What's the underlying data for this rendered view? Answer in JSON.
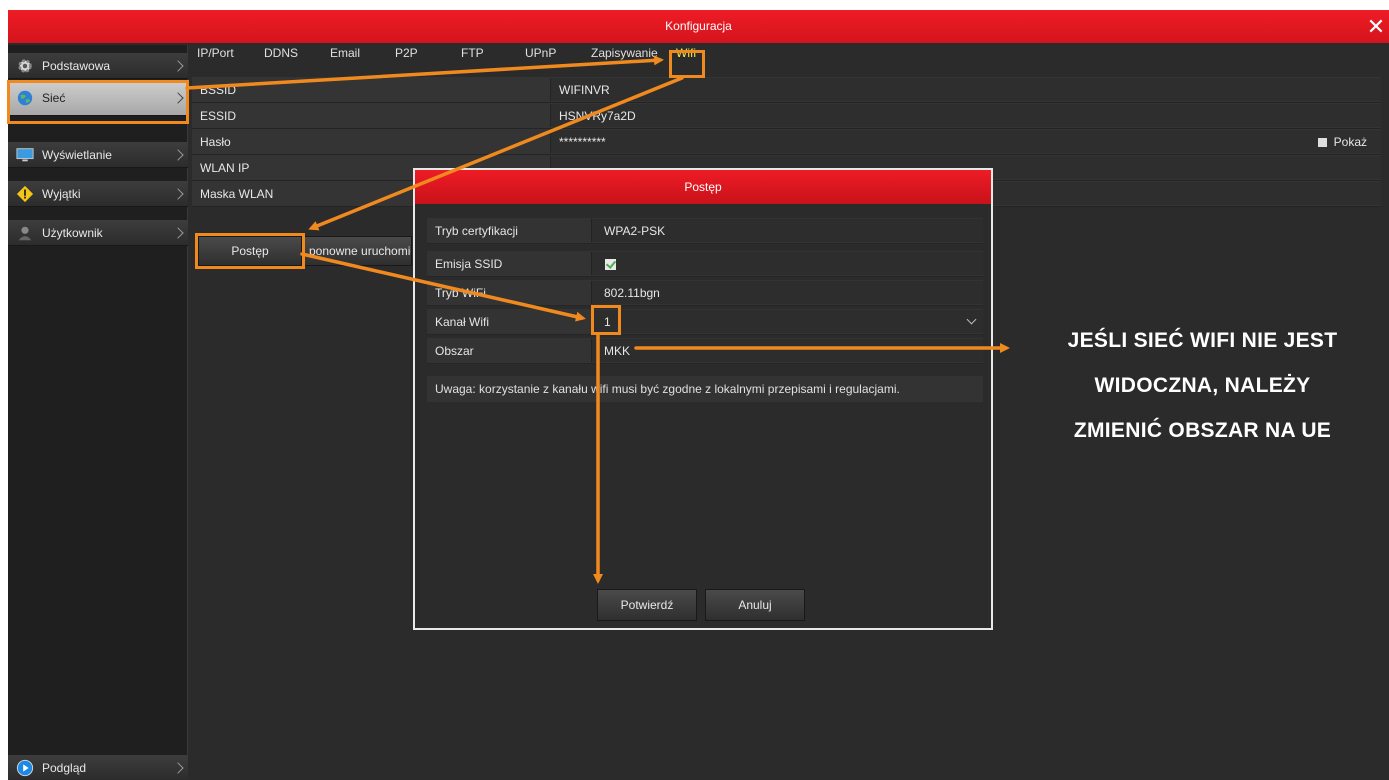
{
  "window": {
    "title": "Konfiguracja",
    "close_symbol": "✕"
  },
  "sidebar": {
    "items": [
      {
        "label": "Podstawowa",
        "icon": "gear-icon"
      },
      {
        "label": "Sieć",
        "icon": "globe-icon"
      },
      {
        "label": "Wyświetlanie",
        "icon": "monitor-icon"
      },
      {
        "label": "Wyjątki",
        "icon": "warning-icon"
      },
      {
        "label": "Użytkownik",
        "icon": "user-icon"
      }
    ],
    "bottom_item": {
      "label": "Podgląd",
      "icon": "play-icon"
    }
  },
  "tabs": [
    "IP/Port",
    "DDNS",
    "Email",
    "P2P",
    "FTP",
    "UPnP",
    "Zapisywanie",
    "Wifi"
  ],
  "active_tab": "Wifi",
  "form": {
    "rows": [
      {
        "label": "BSSID",
        "value": "WIFINVR"
      },
      {
        "label": "ESSID",
        "value": "HSNVRy7a2D"
      },
      {
        "label": "Hasło",
        "value": "**********"
      },
      {
        "label": "WLAN IP",
        "value": ""
      },
      {
        "label": "Maska WLAN",
        "value": ""
      }
    ],
    "show_password_label": "Pokaż"
  },
  "buttons": {
    "progress": "Postęp",
    "restart": "ponowne uruchomieni"
  },
  "dialog": {
    "title": "Postęp",
    "rows": [
      {
        "label": "Tryb certyfikacji",
        "value": "WPA2-PSK"
      },
      {
        "label": "Emisja SSID",
        "value": ""
      },
      {
        "label": "Tryb WiFi",
        "value": "802.11bgn"
      },
      {
        "label": "Kanał Wifi",
        "value": "1"
      },
      {
        "label": "Obszar",
        "value": "MKK"
      }
    ],
    "note": "Uwaga: korzystanie z kanału wifi musi być zgodne z lokalnymi przepisami i regulacjami.",
    "confirm_label": "Potwierdź",
    "cancel_label": "Anuluj"
  },
  "annotation": {
    "line1": "JEŚLI SIEĆ WIFI NIE JEST",
    "line2": "WIDOCZNA, NALEŻY",
    "line3": "ZMIENIĆ OBSZAR NA UE",
    "color": "#f08a1f"
  },
  "colors": {
    "titlebar": "#e31b23",
    "background": "#2b2b2b",
    "highlight": "#f08a1f"
  }
}
